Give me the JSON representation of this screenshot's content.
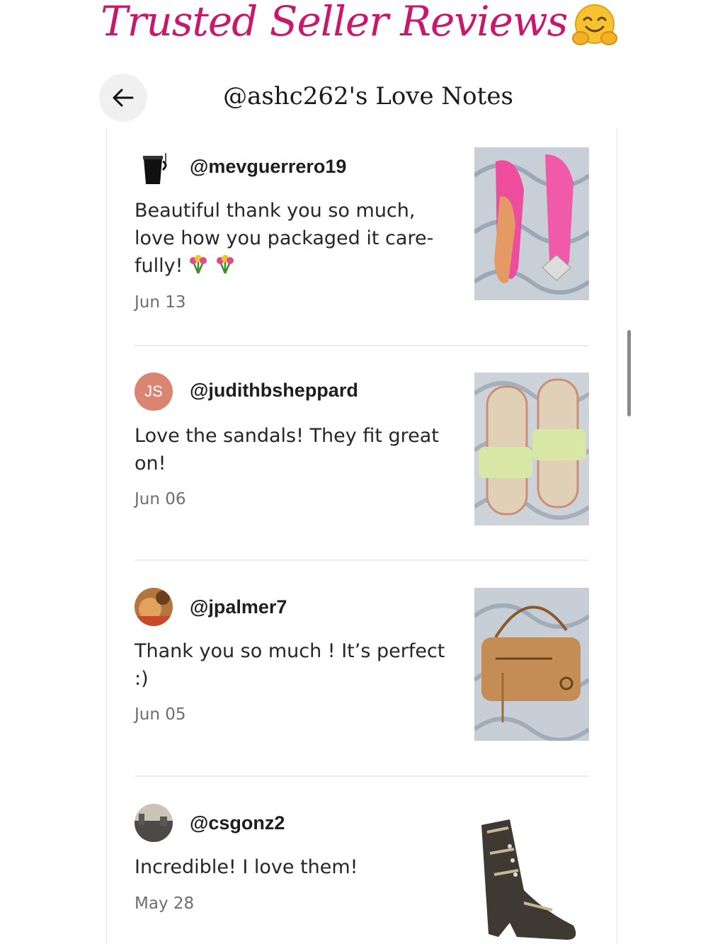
{
  "headline": {
    "text": "Trusted Seller Reviews",
    "emoji": "hugging-face-emoji"
  },
  "header": {
    "back_icon": "arrow-left-icon",
    "title": "@ashc262's Love Notes"
  },
  "colors": {
    "headline": "#c8186e",
    "avatar_js": "#d98572",
    "date": "#6e6e6e"
  },
  "reviews": [
    {
      "username": "@mevguerrero19",
      "avatar": "coffee-cup-avatar",
      "text": "Beautiful thank you so much, love how you packaged it care-fully!",
      "emojis": [
        "tulip-bouquet-emoji",
        "tulip-bouquet-emoji"
      ],
      "date": "Jun 13",
      "image": "pink-slingback-heels-photo"
    },
    {
      "username": "@judithbsheppard",
      "avatar_initials": "JS",
      "text": "Love the sandals! They fit great on!",
      "date": "Jun 06",
      "image": "yellow-slide-sandals-photo"
    },
    {
      "username": "@jpalmer7",
      "avatar": "profile-photo-avatar",
      "text": "Thank you so much ! It’s perfect :)",
      "date": "Jun 05",
      "image": "tan-leather-crossbody-bag-photo"
    },
    {
      "username": "@csgonz2",
      "avatar": "cityscape-avatar",
      "text": "Incredible! I love them!",
      "date": "May 28",
      "image": "snakeskin-ankle-boot-photo"
    }
  ]
}
